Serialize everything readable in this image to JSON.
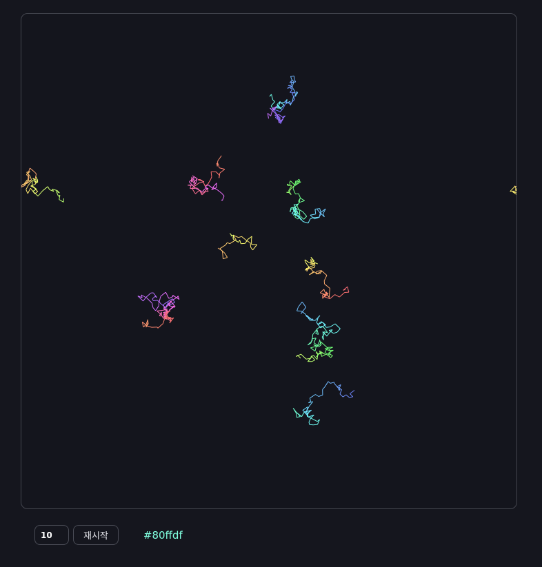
{
  "controls": {
    "walker_count": "10",
    "restart_label": "재시작",
    "current_color": "#80ffdf"
  },
  "colors": {
    "background": "#15161e",
    "border": "#44464f"
  }
}
